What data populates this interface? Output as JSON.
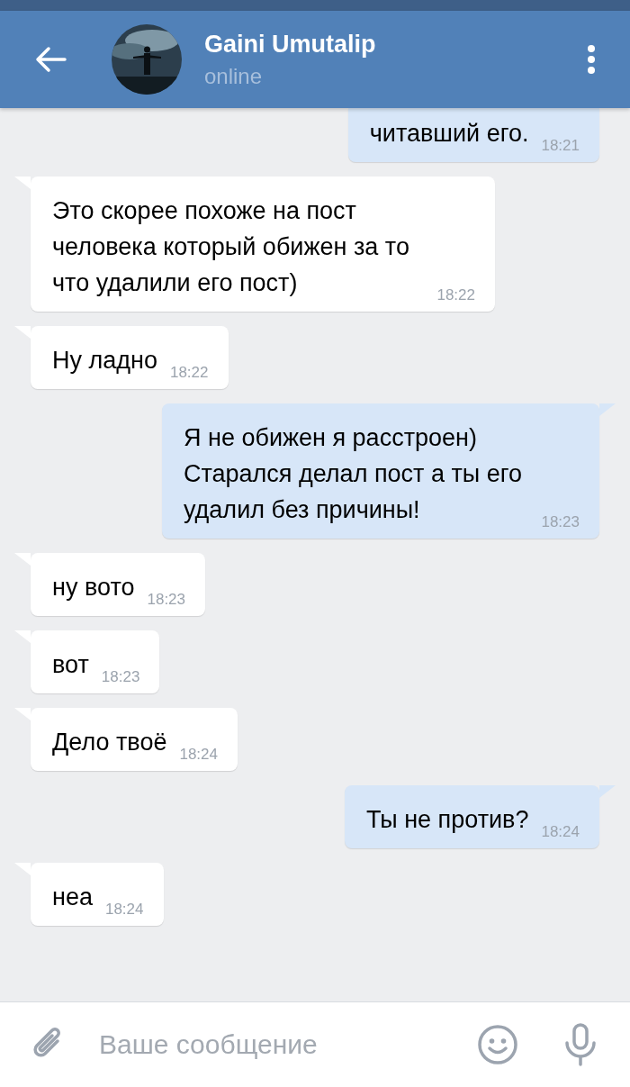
{
  "header": {
    "title": "Gaini Umutalip",
    "status": "online"
  },
  "messages": [
    {
      "kind": "outgoing",
      "text": "читавший его.",
      "time": "18:21"
    },
    {
      "kind": "incoming",
      "text": "Это скорее похоже на пост человека который обижен за то что удалили его пост)",
      "time": "18:22"
    },
    {
      "kind": "incoming",
      "text": "Ну ладно",
      "time": "18:22"
    },
    {
      "kind": "outgoing",
      "text": "Я не обижен я расстроен) Старался делал пост а ты его удалил без причины!",
      "time": "18:23"
    },
    {
      "kind": "incoming",
      "text": "ну вото",
      "time": "18:23"
    },
    {
      "kind": "incoming",
      "text": "вот",
      "time": "18:23"
    },
    {
      "kind": "incoming",
      "text": "Дело твоё",
      "time": "18:24"
    },
    {
      "kind": "outgoing",
      "text": "Ты не против?",
      "time": "18:24"
    },
    {
      "kind": "incoming",
      "text": "неа",
      "time": "18:24"
    }
  ],
  "composer": {
    "placeholder": "Ваше сообщение"
  }
}
